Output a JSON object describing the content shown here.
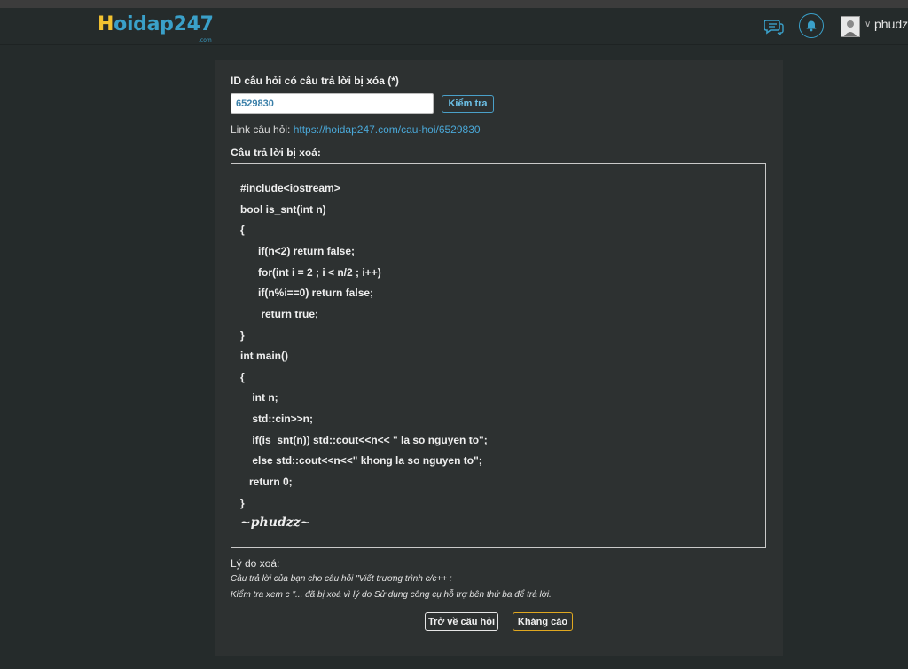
{
  "header": {
    "logo_first": "H",
    "logo_rest": "oidap247",
    "logo_sub": ".com",
    "username": "phudzz",
    "icons": [
      "chat-icon",
      "bell-icon",
      "avatar",
      "chevron-down-icon"
    ]
  },
  "form": {
    "id_label": "ID câu hỏi có câu trả lời bị xóa (*)",
    "id_value": "6529830",
    "check_button": "Kiểm tra",
    "link_label": "Link câu hỏi: ",
    "link_url": "https://hoidap247.com/cau-hoi/6529830",
    "answer_label": "Câu trả lời bị xoá:"
  },
  "answer": {
    "code_lines": [
      "#include<iostream>",
      "bool is_snt(int n)",
      "{",
      "      if(n<2) return false;",
      "      for(int i = 2 ; i < n/2 ; i++)",
      "      if(n%i==0) return false;",
      "       return true;",
      "}",
      "int main()",
      "{",
      "    int n;",
      "    std::cin>>n;",
      "    if(is_snt(n)) std::cout<<n<< \" la so nguyen to\";",
      "    else std::cout<<n<<\" khong la so nguyen to\";",
      "   return 0;",
      "}"
    ],
    "signature": "~phudzz~"
  },
  "reason": {
    "label": "Lý do xoá:",
    "line1": "Câu trả lời của bạn cho câu hỏi \"Viết trương trình c/c++ :",
    "line2": "Kiểm tra xem c \"... đã bị xoá vì lý do Sử dụng công cụ hỗ trợ bên thứ ba để trả lời."
  },
  "actions": {
    "back_button": "Trở về câu hỏi",
    "appeal_button": "Kháng cáo"
  },
  "colors": {
    "background": "#252b2b",
    "panel": "#2d3131",
    "accent_blue": "#3aa0c9",
    "accent_yellow": "#f2c230",
    "appeal_border": "#e0a820"
  }
}
